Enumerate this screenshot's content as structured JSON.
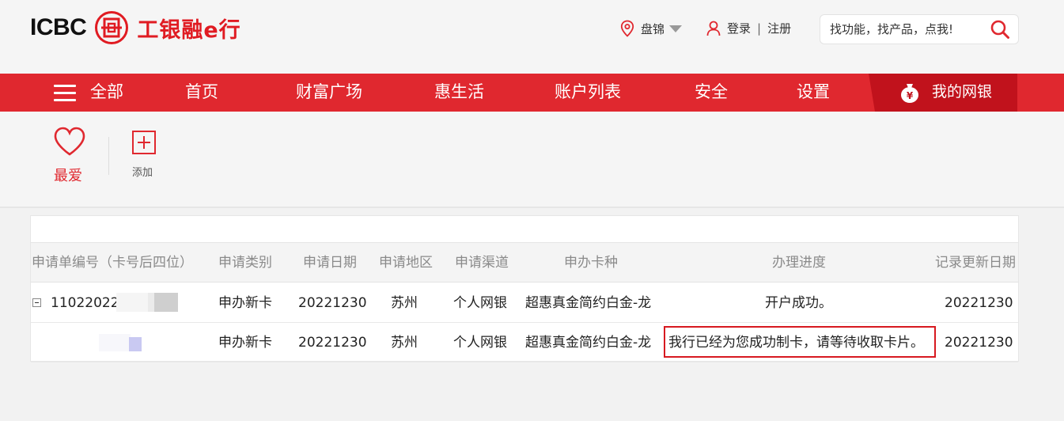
{
  "header": {
    "logo_text": "ICBC",
    "logo_cn": "工银融e行",
    "location": "盘锦",
    "login": "登录",
    "separator": "|",
    "register": "注册",
    "search_placeholder": "找功能，找产品，点我!"
  },
  "nav": {
    "all": "全部",
    "items": [
      "首页",
      "财富广场",
      "惠生活",
      "账户列表",
      "安全",
      "设置"
    ],
    "mybank": "我的网银"
  },
  "favorites": {
    "fav_label": "最爱",
    "add_label": "添加"
  },
  "table": {
    "columns": [
      "申请单编号（卡号后四位）",
      "申请类别",
      "申请日期",
      "申请地区",
      "申请渠道",
      "申办卡种",
      "办理进度",
      "记录更新日期"
    ],
    "rows": [
      {
        "id": "11022022",
        "category": "申办新卡",
        "date": "20221230",
        "region": "苏州",
        "channel": "个人网银",
        "card": "超惠真金简约白金-龙",
        "progress": "开户成功。",
        "updated": "20221230"
      },
      {
        "id": "",
        "category": "申办新卡",
        "date": "20221230",
        "region": "苏州",
        "channel": "个人网银",
        "card": "超惠真金简约白金-龙",
        "progress": "我行已经为您成功制卡，请等待收取卡片。",
        "updated": "20221230"
      }
    ]
  },
  "colors": {
    "brand_red": "#e0282f",
    "dark_red": "#c1121c",
    "highlight_border": "#d71920"
  }
}
